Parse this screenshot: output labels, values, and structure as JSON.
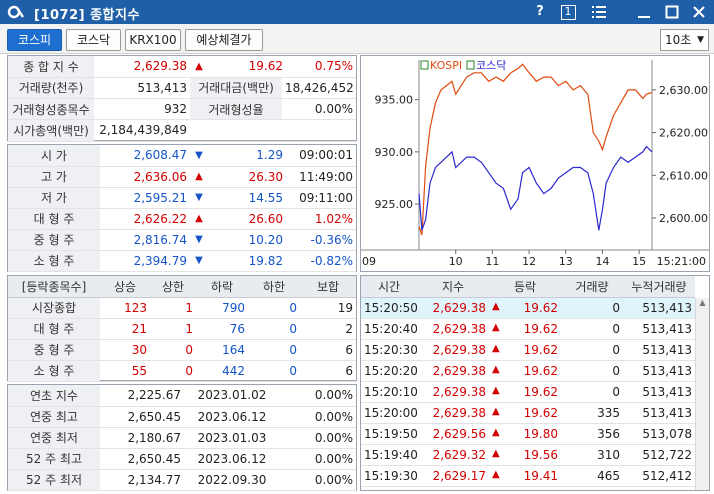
{
  "window": {
    "title": "[1072] 종합지수",
    "help": "?",
    "page_no": "1"
  },
  "toolbar": {
    "tabs": [
      "코스피",
      "코스닥",
      "KRX100",
      "예상체결가"
    ],
    "interval": "10초"
  },
  "summary": {
    "row1": {
      "label": "종 합 지 수",
      "value": "2,629.38",
      "change": "19.62",
      "rate": "0.75%"
    },
    "row2": {
      "label": "거래량(천주)",
      "value": "513,413",
      "label2": "거래대금(백만)",
      "value2": "18,426,452"
    },
    "row3": {
      "label": "거래형성종목수",
      "value": "932",
      "label2": "거래형성율",
      "value2": "0.00%"
    },
    "row4": {
      "label": "시가총액(백만)",
      "value": "2,184,439,849"
    }
  },
  "prices": [
    {
      "label": "시      가",
      "value": "2,608.47",
      "change": "1.29",
      "extra": "09:00:01"
    },
    {
      "label": "고      가",
      "value": "2,636.06",
      "change": "26.30",
      "extra": "11:49:00"
    },
    {
      "label": "저      가",
      "value": "2,595.21",
      "change": "14.55",
      "extra": "09:11:00"
    },
    {
      "label": "대 형 주",
      "value": "2,626.22",
      "change": "26.60",
      "extra": "1.02%"
    },
    {
      "label": "중 형 주",
      "value": "2,816.74",
      "change": "10.20",
      "extra": "-0.36%"
    },
    {
      "label": "소 형 주",
      "value": "2,394.79",
      "change": "19.82",
      "extra": "-0.82%"
    }
  ],
  "breadth": {
    "headers": [
      "[등락종목수]",
      "상승",
      "상한",
      "하락",
      "하한",
      "보합"
    ],
    "rows": [
      {
        "label": "시장종합",
        "up": "123",
        "upper": "1",
        "down": "790",
        "lower": "0",
        "flat": "19"
      },
      {
        "label": "대 형 주",
        "up": "21",
        "upper": "1",
        "down": "76",
        "lower": "0",
        "flat": "2"
      },
      {
        "label": "중 형 주",
        "up": "30",
        "upper": "0",
        "down": "164",
        "lower": "0",
        "flat": "6"
      },
      {
        "label": "소 형 주",
        "up": "55",
        "upper": "0",
        "down": "442",
        "lower": "0",
        "flat": "6"
      }
    ]
  },
  "yearly": [
    {
      "label": "연초  지수",
      "value": "2,225.67",
      "date": "2023.01.02",
      "rate": "0.00%"
    },
    {
      "label": "연중  최고",
      "value": "2,650.45",
      "date": "2023.06.12",
      "rate": "0.00%"
    },
    {
      "label": "연중  최저",
      "value": "2,180.67",
      "date": "2023.01.03",
      "rate": "0.00%"
    },
    {
      "label": "52 주 최고",
      "value": "2,650.45",
      "date": "2023.06.12",
      "rate": "0.00%"
    },
    {
      "label": "52 주 최저",
      "value": "2,134.77",
      "date": "2022.09.30",
      "rate": "0.00%"
    }
  ],
  "ticks": {
    "headers": [
      "시간",
      "지수",
      "등락",
      "거래량",
      "누적거래량"
    ],
    "rows": [
      {
        "time": "15:20:50",
        "index": "2,629.38",
        "change": "19.62",
        "volume": "0",
        "cum": "513,413"
      },
      {
        "time": "15:20:40",
        "index": "2,629.38",
        "change": "19.62",
        "volume": "0",
        "cum": "513,413"
      },
      {
        "time": "15:20:30",
        "index": "2,629.38",
        "change": "19.62",
        "volume": "0",
        "cum": "513,413"
      },
      {
        "time": "15:20:20",
        "index": "2,629.38",
        "change": "19.62",
        "volume": "0",
        "cum": "513,413"
      },
      {
        "time": "15:20:10",
        "index": "2,629.38",
        "change": "19.62",
        "volume": "0",
        "cum": "513,413"
      },
      {
        "time": "15:20:00",
        "index": "2,629.38",
        "change": "19.62",
        "volume": "335",
        "cum": "513,413"
      },
      {
        "time": "15:19:50",
        "index": "2,629.56",
        "change": "19.80",
        "volume": "356",
        "cum": "513,078"
      },
      {
        "time": "15:19:40",
        "index": "2,629.32",
        "change": "19.56",
        "volume": "310",
        "cum": "512,722"
      },
      {
        "time": "15:19:30",
        "index": "2,629.17",
        "change": "19.41",
        "volume": "465",
        "cum": "512,412"
      }
    ]
  },
  "chart_data": {
    "type": "line",
    "legend": [
      "KOSPI",
      "코스닥"
    ],
    "x_ticks": [
      "09",
      "10",
      "11",
      "12",
      "13",
      "14",
      "15",
      "15:21:00"
    ],
    "y_left_ticks": [
      "935.00",
      "930.00",
      "925.00"
    ],
    "y_right_ticks": [
      "2,630.00",
      "2,620.00",
      "2,610.00",
      "2,600.00"
    ],
    "y_left_range": [
      920.6,
      938.8
    ],
    "y_right_range": [
      2592.5,
      2637.0
    ],
    "series": [
      {
        "name": "KOSPI",
        "axis": "right",
        "color": "#e04a10",
        "x": [
          9.0,
          9.08,
          9.18,
          9.3,
          9.45,
          9.6,
          9.75,
          9.9,
          10.0,
          10.15,
          10.3,
          10.5,
          10.7,
          10.9,
          11.1,
          11.3,
          11.5,
          11.7,
          11.82,
          12.0,
          12.2,
          12.4,
          12.6,
          12.8,
          13.0,
          13.2,
          13.4,
          13.6,
          13.75,
          13.9,
          14.0,
          14.1,
          14.3,
          14.5,
          14.7,
          14.9,
          15.1,
          15.2,
          15.35
        ],
        "values": [
          2598,
          2596,
          2612,
          2621,
          2627,
          2630,
          2631,
          2632,
          2629,
          2631,
          2633,
          2634,
          2634,
          2632,
          2633,
          2632,
          2634,
          2635,
          2636,
          2634,
          2632,
          2633,
          2633,
          2631,
          2632,
          2630,
          2631,
          2629,
          2620,
          2618,
          2616,
          2619,
          2624,
          2627,
          2630,
          2630,
          2628,
          2629,
          2629.4
        ]
      },
      {
        "name": "코스닥",
        "axis": "left",
        "color": "#2a28d0",
        "x": [
          9.0,
          9.08,
          9.18,
          9.3,
          9.45,
          9.6,
          9.75,
          9.9,
          10.0,
          10.15,
          10.3,
          10.5,
          10.7,
          10.9,
          11.1,
          11.3,
          11.5,
          11.7,
          11.82,
          12.0,
          12.2,
          12.4,
          12.6,
          12.8,
          13.0,
          13.2,
          13.4,
          13.6,
          13.75,
          13.9,
          14.0,
          14.1,
          14.3,
          14.5,
          14.7,
          14.9,
          15.1,
          15.2,
          15.35
        ],
        "values": [
          926,
          922.5,
          923.5,
          927,
          928.5,
          929,
          929.5,
          930,
          928.5,
          929,
          929.5,
          929.5,
          929,
          928,
          927,
          926.5,
          924.5,
          925.5,
          928,
          928.5,
          927,
          926,
          926.5,
          927.5,
          928,
          928.5,
          928.5,
          928,
          926,
          922.5,
          924.5,
          927,
          928.5,
          929.5,
          929,
          929.5,
          930,
          930.5,
          930
        ]
      }
    ]
  }
}
